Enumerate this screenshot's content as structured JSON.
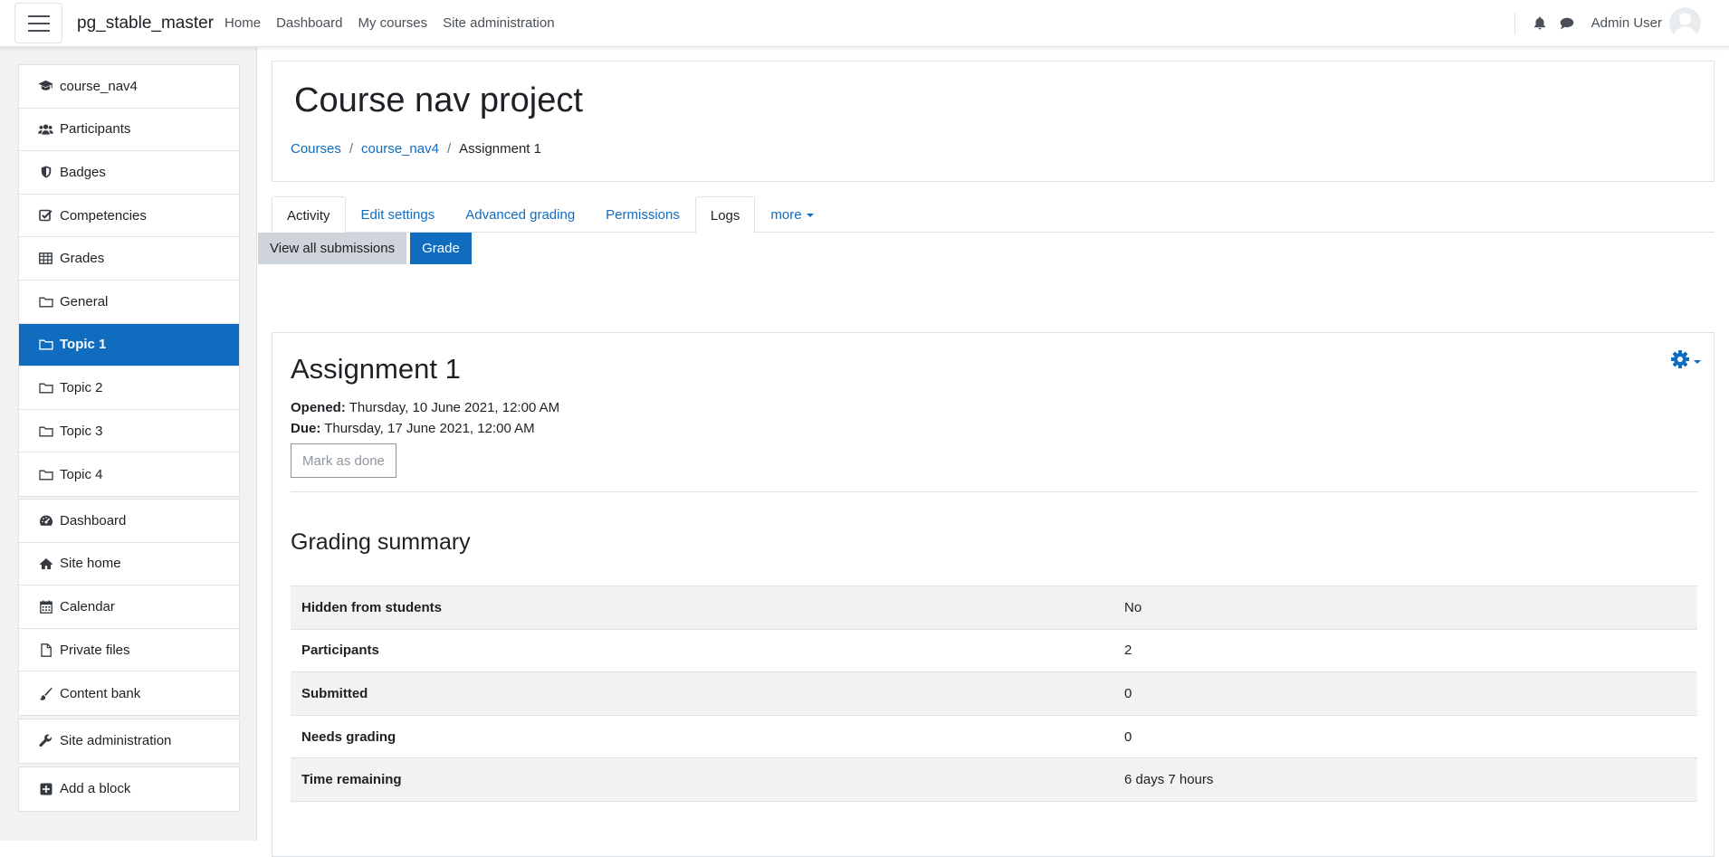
{
  "site_name": "pg_stable_master",
  "top_nav": [
    "Home",
    "Dashboard",
    "My courses",
    "Site administration"
  ],
  "user": {
    "name": "Admin User"
  },
  "icons": {
    "notifications": "bell-icon",
    "messages": "chat-icon",
    "menu": "hamburger-icon"
  },
  "colors": {
    "primary": "#0f6cbf",
    "secondary_button": "#ced4da",
    "drawer_bg": "#f2f2f2"
  },
  "drawer": {
    "course_items": [
      {
        "label": "course_nav4",
        "icon": "graduation-cap-icon"
      },
      {
        "label": "Participants",
        "icon": "users-icon"
      },
      {
        "label": "Badges",
        "icon": "shield-icon"
      },
      {
        "label": "Competencies",
        "icon": "check-square-icon"
      },
      {
        "label": "Grades",
        "icon": "table-icon"
      },
      {
        "label": "General",
        "icon": "folder-icon"
      },
      {
        "label": "Topic 1",
        "icon": "folder-icon",
        "active": true
      },
      {
        "label": "Topic 2",
        "icon": "folder-icon"
      },
      {
        "label": "Topic 3",
        "icon": "folder-icon"
      },
      {
        "label": "Topic 4",
        "icon": "folder-icon"
      }
    ],
    "site_items": [
      {
        "label": "Dashboard",
        "icon": "tachometer-icon"
      },
      {
        "label": "Site home",
        "icon": "home-icon"
      },
      {
        "label": "Calendar",
        "icon": "calendar-icon"
      },
      {
        "label": "Private files",
        "icon": "file-icon"
      },
      {
        "label": "Content bank",
        "icon": "paint-brush-icon"
      }
    ],
    "admin_item": {
      "label": "Site administration",
      "icon": "wrench-icon"
    },
    "add_block": {
      "label": "Add a block",
      "icon": "plus-square-icon"
    }
  },
  "page": {
    "title": "Course nav project",
    "breadcrumb": [
      "Courses",
      "course_nav4",
      "Assignment 1"
    ]
  },
  "tabs": [
    "Activity",
    "Edit settings",
    "Advanced grading",
    "Permissions",
    "Logs",
    "more"
  ],
  "actions": {
    "view_all": "View all submissions",
    "grade": "Grade"
  },
  "assignment": {
    "title": "Assignment 1",
    "opened_label": "Opened:",
    "opened_value": "Thursday, 10 June 2021, 12:00 AM",
    "due_label": "Due:",
    "due_value": "Thursday, 17 June 2021, 12:00 AM",
    "mark_done": "Mark as done"
  },
  "grading_summary": {
    "title": "Grading summary",
    "rows": [
      {
        "label": "Hidden from students",
        "value": "No"
      },
      {
        "label": "Participants",
        "value": "2"
      },
      {
        "label": "Submitted",
        "value": "0"
      },
      {
        "label": "Needs grading",
        "value": "0"
      },
      {
        "label": "Time remaining",
        "value": "6 days 7 hours"
      }
    ]
  }
}
